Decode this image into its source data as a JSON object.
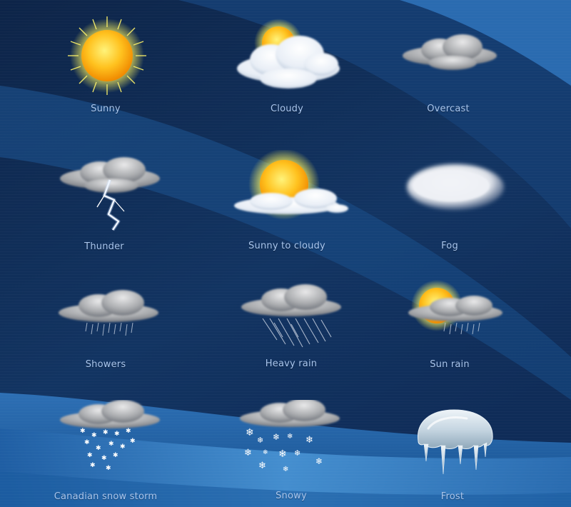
{
  "icons": [
    {
      "key": "sunny",
      "label": "Sunny",
      "icon": "sun-icon"
    },
    {
      "key": "cloudy",
      "label": "Cloudy",
      "icon": "cloudy-icon"
    },
    {
      "key": "overcast",
      "label": "Overcast",
      "icon": "overcast-icon"
    },
    {
      "key": "thunder",
      "label": "Thunder",
      "icon": "thunder-icon"
    },
    {
      "key": "sunny-to-cloudy",
      "label": "Sunny to cloudy",
      "icon": "sunny-to-cloudy-icon"
    },
    {
      "key": "fog",
      "label": "Fog",
      "icon": "fog-icon"
    },
    {
      "key": "showers",
      "label": "Showers",
      "icon": "showers-icon"
    },
    {
      "key": "heavy-rain",
      "label": "Heavy rain",
      "icon": "heavy-rain-icon"
    },
    {
      "key": "sun-rain",
      "label": "Sun rain",
      "icon": "sun-rain-icon"
    },
    {
      "key": "canadian-snow-storm",
      "label": "Canadian snow storm",
      "icon": "snow-storm-icon"
    },
    {
      "key": "snowy",
      "label": "Snowy",
      "icon": "snowy-icon"
    },
    {
      "key": "frost",
      "label": "Frost",
      "icon": "frost-icon"
    }
  ],
  "colors": {
    "background_dark": "#0f2a52",
    "background_mid": "#1a4a82",
    "band_light": "#3e86c8",
    "label_text": "#a9c6ee",
    "sun_core": "#ffbf1a",
    "sun_glow": "#fff36a"
  }
}
